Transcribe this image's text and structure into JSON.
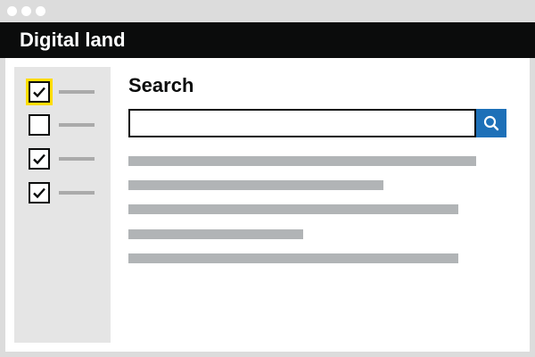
{
  "header": {
    "title": "Digital land"
  },
  "search": {
    "heading": "Search",
    "value": "",
    "placeholder": ""
  },
  "filters": [
    {
      "checked": true,
      "focused": true
    },
    {
      "checked": false,
      "focused": false
    },
    {
      "checked": true,
      "focused": false
    },
    {
      "checked": true,
      "focused": false
    }
  ],
  "colors": {
    "header_bg": "#0b0c0c",
    "focus": "#ffdd00",
    "search_button": "#1d70b8",
    "sidebar_bg": "#e5e5e5",
    "placeholder_text": "#b1b4b6"
  },
  "icons": {
    "search_button": "search-icon",
    "checkbox": "checkmark-icon"
  }
}
